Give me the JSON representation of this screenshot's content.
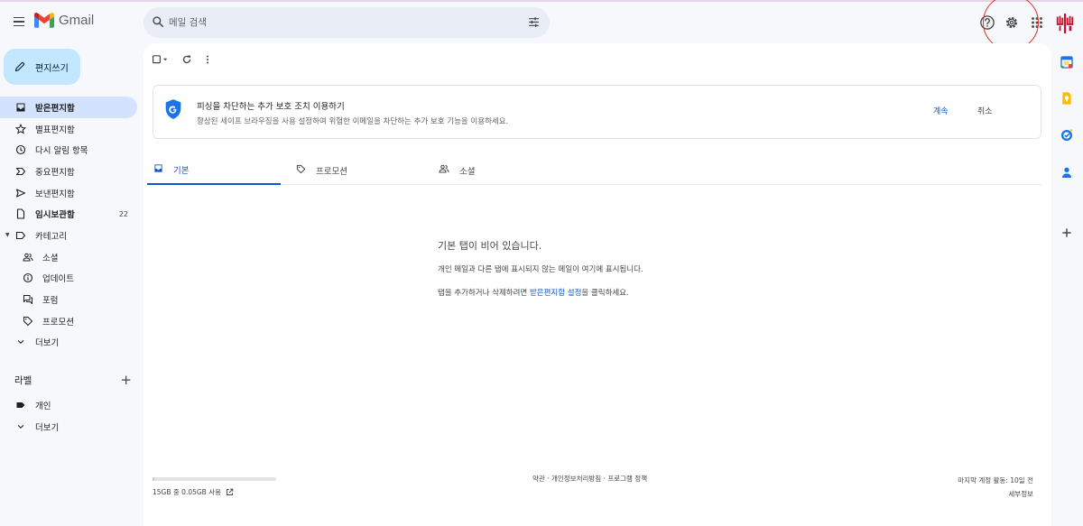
{
  "app": {
    "name": "Gmail"
  },
  "header": {
    "search_placeholder": "메일 검색"
  },
  "sidebar": {
    "compose_label": "편지쓰기",
    "items": [
      {
        "label": "받은편지함",
        "icon": "inbox-icon",
        "active": true,
        "bold": true,
        "count": ""
      },
      {
        "label": "별표편지함",
        "icon": "star-icon",
        "count": ""
      },
      {
        "label": "다시 알림 항목",
        "icon": "clock-icon",
        "count": ""
      },
      {
        "label": "중요편지함",
        "icon": "important-icon",
        "count": ""
      },
      {
        "label": "보낸편지함",
        "icon": "send-icon",
        "count": ""
      },
      {
        "label": "임시보관함",
        "icon": "draft-icon",
        "bold": true,
        "count": "22"
      },
      {
        "label": "카테고리",
        "icon": "label-outline-icon",
        "count": ""
      },
      {
        "label": "소셜",
        "icon": "people-icon",
        "sub": true,
        "count": ""
      },
      {
        "label": "업데이트",
        "icon": "info-icon",
        "sub": true,
        "count": ""
      },
      {
        "label": "포럼",
        "icon": "forum-icon",
        "sub": true,
        "count": ""
      },
      {
        "label": "프로모션",
        "icon": "tag-icon",
        "sub": true,
        "count": ""
      },
      {
        "label": "더보기",
        "icon": "chevron-down-icon",
        "count": ""
      }
    ],
    "labels_title": "라벨",
    "labels": [
      {
        "label": "개인",
        "icon": "label-filled-icon"
      },
      {
        "label": "더보기",
        "icon": "chevron-down-icon"
      }
    ]
  },
  "banner": {
    "title": "피싱을 차단하는 추가 보호 조치 이용하기",
    "description": "향상된 세이프 브라우징을 사용 설정하여 위험한 이메일을 차단하는 추가 보호 기능을 이용하세요.",
    "continue_label": "계속",
    "cancel_label": "취소"
  },
  "tabs": [
    {
      "label": "기본",
      "icon": "inbox-icon",
      "active": true
    },
    {
      "label": "프로모션",
      "icon": "tag-icon"
    },
    {
      "label": "소셜",
      "icon": "people-icon"
    }
  ],
  "empty_state": {
    "title": "기본 탭이 비어 있습니다.",
    "line1": "개인 메일과 다른 탭에 표시되지 않는 메일이 여기에 표시됩니다.",
    "line2_prefix": "탭을 추가하거나 삭제하려면 ",
    "line2_link": "받은편지함 설정",
    "line2_suffix": "을 클릭하세요."
  },
  "footer": {
    "storage_text": "15GB 중 0.05GB 사용",
    "storage_fraction": 0.0033,
    "links": [
      "약관",
      "개인정보처리방침",
      "프로그램 정책"
    ],
    "activity": "마지막 계정 활동: 10일 전",
    "details": "세부정보"
  },
  "colors": {
    "accent": "#0b57d0",
    "compose_bg": "#c2e7ff",
    "active_nav_bg": "#d3e3fd",
    "annotation_circle": "#d93025"
  }
}
